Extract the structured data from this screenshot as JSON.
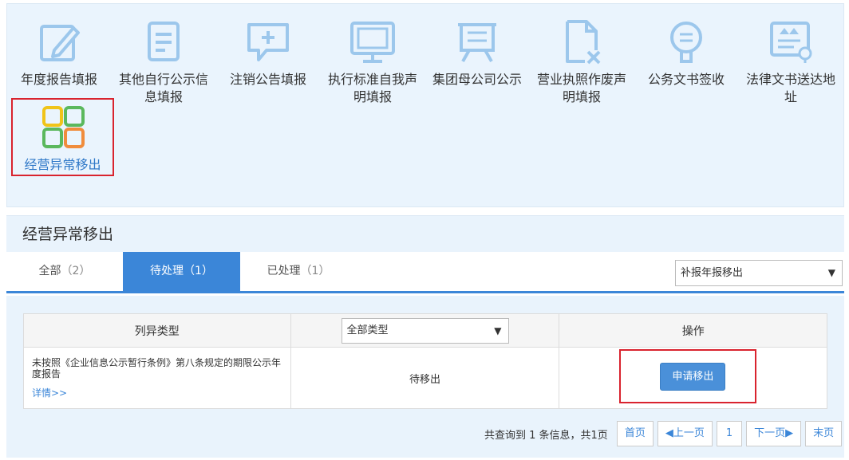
{
  "services": [
    {
      "label": "年度报告填报",
      "icon": "edit-report-icon"
    },
    {
      "label": "其他自行公示信\n息填报",
      "icon": "document-icon"
    },
    {
      "label": "注销公告填报",
      "icon": "chat-plus-icon"
    },
    {
      "label": "执行标准自我声\n明填报",
      "icon": "monitor-icon"
    },
    {
      "label": "集团母公司公示",
      "icon": "easel-board-icon"
    },
    {
      "label": "营业执照作废声\n明填报",
      "icon": "file-cancel-icon"
    },
    {
      "label": "公务文书签收",
      "icon": "badge-icon"
    },
    {
      "label": "法律文书送达地\n址",
      "icon": "address-card-icon"
    }
  ],
  "active_service": {
    "label": "经营异常移出",
    "icon": "four-squares-icon"
  },
  "section_title": "经营异常移出",
  "tabs": [
    {
      "label": "全部",
      "count": "（2）"
    },
    {
      "label": "待处理",
      "count": "（1）"
    },
    {
      "label": "已处理",
      "count": "（1）"
    }
  ],
  "filter_select": "补报年报移出",
  "table": {
    "headers": {
      "type": "列异类型",
      "type_filter": "全部类型",
      "action": "操作"
    },
    "rows": [
      {
        "reason": "未按照《企业信息公示暂行条例》第八条规定的期限公示年度报告",
        "detail": "详情>>",
        "status": "待移出",
        "action": "申请移出"
      }
    ]
  },
  "pagination": {
    "summary": "共查询到 1 条信息，共1页",
    "first": "首页",
    "prev": "◀上一页",
    "page": "1",
    "next": "下一页▶",
    "last": "末页"
  },
  "colors": {
    "accent": "#3b86d8",
    "highlight": "#d9232e",
    "icon_blue": "#9cc7ec"
  }
}
